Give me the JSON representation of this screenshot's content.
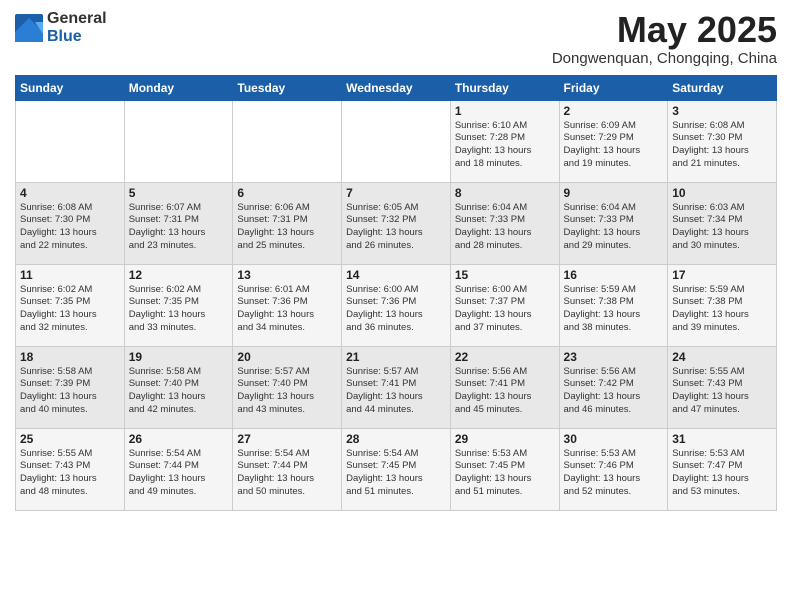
{
  "logo": {
    "general": "General",
    "blue": "Blue"
  },
  "title": "May 2025",
  "location": "Dongwenquan, Chongqing, China",
  "days_of_week": [
    "Sunday",
    "Monday",
    "Tuesday",
    "Wednesday",
    "Thursday",
    "Friday",
    "Saturday"
  ],
  "weeks": [
    [
      {
        "day": "",
        "info": ""
      },
      {
        "day": "",
        "info": ""
      },
      {
        "day": "",
        "info": ""
      },
      {
        "day": "",
        "info": ""
      },
      {
        "day": "1",
        "info": "Sunrise: 6:10 AM\nSunset: 7:28 PM\nDaylight: 13 hours\nand 18 minutes."
      },
      {
        "day": "2",
        "info": "Sunrise: 6:09 AM\nSunset: 7:29 PM\nDaylight: 13 hours\nand 19 minutes."
      },
      {
        "day": "3",
        "info": "Sunrise: 6:08 AM\nSunset: 7:30 PM\nDaylight: 13 hours\nand 21 minutes."
      }
    ],
    [
      {
        "day": "4",
        "info": "Sunrise: 6:08 AM\nSunset: 7:30 PM\nDaylight: 13 hours\nand 22 minutes."
      },
      {
        "day": "5",
        "info": "Sunrise: 6:07 AM\nSunset: 7:31 PM\nDaylight: 13 hours\nand 23 minutes."
      },
      {
        "day": "6",
        "info": "Sunrise: 6:06 AM\nSunset: 7:31 PM\nDaylight: 13 hours\nand 25 minutes."
      },
      {
        "day": "7",
        "info": "Sunrise: 6:05 AM\nSunset: 7:32 PM\nDaylight: 13 hours\nand 26 minutes."
      },
      {
        "day": "8",
        "info": "Sunrise: 6:04 AM\nSunset: 7:33 PM\nDaylight: 13 hours\nand 28 minutes."
      },
      {
        "day": "9",
        "info": "Sunrise: 6:04 AM\nSunset: 7:33 PM\nDaylight: 13 hours\nand 29 minutes."
      },
      {
        "day": "10",
        "info": "Sunrise: 6:03 AM\nSunset: 7:34 PM\nDaylight: 13 hours\nand 30 minutes."
      }
    ],
    [
      {
        "day": "11",
        "info": "Sunrise: 6:02 AM\nSunset: 7:35 PM\nDaylight: 13 hours\nand 32 minutes."
      },
      {
        "day": "12",
        "info": "Sunrise: 6:02 AM\nSunset: 7:35 PM\nDaylight: 13 hours\nand 33 minutes."
      },
      {
        "day": "13",
        "info": "Sunrise: 6:01 AM\nSunset: 7:36 PM\nDaylight: 13 hours\nand 34 minutes."
      },
      {
        "day": "14",
        "info": "Sunrise: 6:00 AM\nSunset: 7:36 PM\nDaylight: 13 hours\nand 36 minutes."
      },
      {
        "day": "15",
        "info": "Sunrise: 6:00 AM\nSunset: 7:37 PM\nDaylight: 13 hours\nand 37 minutes."
      },
      {
        "day": "16",
        "info": "Sunrise: 5:59 AM\nSunset: 7:38 PM\nDaylight: 13 hours\nand 38 minutes."
      },
      {
        "day": "17",
        "info": "Sunrise: 5:59 AM\nSunset: 7:38 PM\nDaylight: 13 hours\nand 39 minutes."
      }
    ],
    [
      {
        "day": "18",
        "info": "Sunrise: 5:58 AM\nSunset: 7:39 PM\nDaylight: 13 hours\nand 40 minutes."
      },
      {
        "day": "19",
        "info": "Sunrise: 5:58 AM\nSunset: 7:40 PM\nDaylight: 13 hours\nand 42 minutes."
      },
      {
        "day": "20",
        "info": "Sunrise: 5:57 AM\nSunset: 7:40 PM\nDaylight: 13 hours\nand 43 minutes."
      },
      {
        "day": "21",
        "info": "Sunrise: 5:57 AM\nSunset: 7:41 PM\nDaylight: 13 hours\nand 44 minutes."
      },
      {
        "day": "22",
        "info": "Sunrise: 5:56 AM\nSunset: 7:41 PM\nDaylight: 13 hours\nand 45 minutes."
      },
      {
        "day": "23",
        "info": "Sunrise: 5:56 AM\nSunset: 7:42 PM\nDaylight: 13 hours\nand 46 minutes."
      },
      {
        "day": "24",
        "info": "Sunrise: 5:55 AM\nSunset: 7:43 PM\nDaylight: 13 hours\nand 47 minutes."
      }
    ],
    [
      {
        "day": "25",
        "info": "Sunrise: 5:55 AM\nSunset: 7:43 PM\nDaylight: 13 hours\nand 48 minutes."
      },
      {
        "day": "26",
        "info": "Sunrise: 5:54 AM\nSunset: 7:44 PM\nDaylight: 13 hours\nand 49 minutes."
      },
      {
        "day": "27",
        "info": "Sunrise: 5:54 AM\nSunset: 7:44 PM\nDaylight: 13 hours\nand 50 minutes."
      },
      {
        "day": "28",
        "info": "Sunrise: 5:54 AM\nSunset: 7:45 PM\nDaylight: 13 hours\nand 51 minutes."
      },
      {
        "day": "29",
        "info": "Sunrise: 5:53 AM\nSunset: 7:45 PM\nDaylight: 13 hours\nand 51 minutes."
      },
      {
        "day": "30",
        "info": "Sunrise: 5:53 AM\nSunset: 7:46 PM\nDaylight: 13 hours\nand 52 minutes."
      },
      {
        "day": "31",
        "info": "Sunrise: 5:53 AM\nSunset: 7:47 PM\nDaylight: 13 hours\nand 53 minutes."
      }
    ]
  ]
}
